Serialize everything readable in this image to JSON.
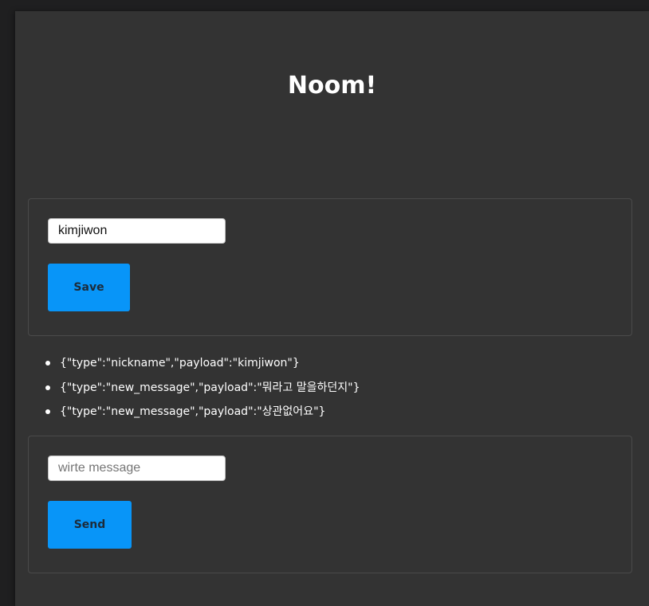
{
  "app": {
    "title": "Noom!"
  },
  "nickname_form": {
    "input_value": "kimjiwon",
    "input_placeholder": "",
    "save_label": "Save"
  },
  "messages": [
    "{\"type\":\"nickname\",\"payload\":\"kimjiwon\"}",
    "{\"type\":\"new_message\",\"payload\":\"뭐라고 말을하던지\"}",
    "{\"type\":\"new_message\",\"payload\":\"상관없어요\"}"
  ],
  "message_form": {
    "input_value": "",
    "input_placeholder": "wirte message",
    "send_label": "Send"
  },
  "colors": {
    "background": "#1f1f20",
    "panel": "#333333",
    "button": "#0895f8",
    "button_text": "#1c2b3a",
    "text": "#ffffff"
  }
}
